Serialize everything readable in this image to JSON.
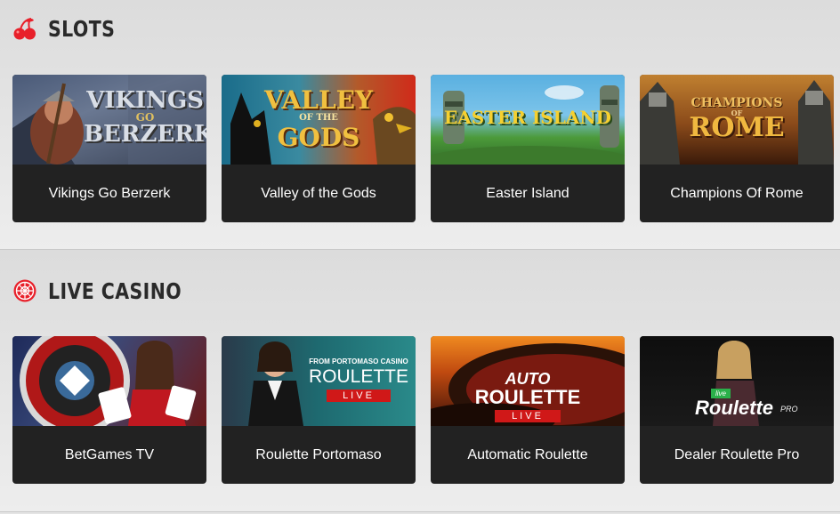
{
  "sections": {
    "slots": {
      "title": "SLOTS",
      "icon": "cherries-icon",
      "games": [
        {
          "name": "Vikings Go Berzerk",
          "art_line1": "VIKINGS",
          "art_line2": "GO",
          "art_line3": "BERZERK"
        },
        {
          "name": "Valley of the Gods",
          "art_line1": "VALLEY",
          "art_line2": "OF THE",
          "art_line3": "GODS"
        },
        {
          "name": "Easter Island",
          "art_line1": "EASTER ISLAND"
        },
        {
          "name": "Champions Of Rome",
          "art_line1": "CHAMPIONS",
          "art_line2": "OF",
          "art_line3": "ROME"
        }
      ]
    },
    "live": {
      "title": "LIVE CASINO",
      "icon": "roulette-wheel-icon",
      "games": [
        {
          "name": "BetGames TV"
        },
        {
          "name": "Roulette Portomaso",
          "art_line1": "FROM PORTOMASO CASINO",
          "art_line2": "ROULETTE",
          "art_line3": "LIVE"
        },
        {
          "name": "Automatic Roulette",
          "art_line1": "AUTO",
          "art_line2": "ROULETTE",
          "art_line3": "LIVE"
        },
        {
          "name": "Dealer Roulette Pro",
          "art_line1": "live",
          "art_line2": "Roulette",
          "art_line3": "PRO"
        }
      ]
    }
  },
  "colors": {
    "accent": "#e8202a",
    "card_bg": "#222222",
    "page_bg": "#e4e4e4"
  }
}
